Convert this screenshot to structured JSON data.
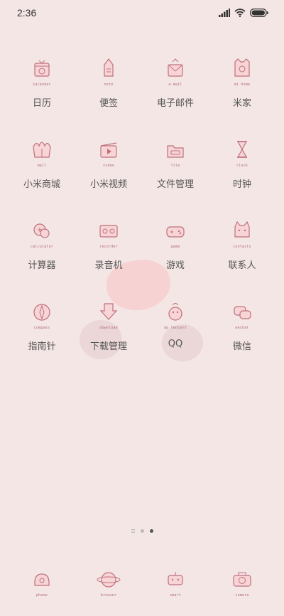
{
  "status_bar": {
    "time": "2:36"
  },
  "home_grid": [
    {
      "label": "日历",
      "tiny": "calendar",
      "icon": "calendar-icon"
    },
    {
      "label": "便签",
      "tiny": "note",
      "icon": "note-icon"
    },
    {
      "label": "电子邮件",
      "tiny": "e-mail",
      "icon": "email-icon"
    },
    {
      "label": "米家",
      "tiny": "mi home",
      "icon": "mi-home-icon"
    },
    {
      "label": "小米商城",
      "tiny": "mall",
      "icon": "mall-icon"
    },
    {
      "label": "小米视频",
      "tiny": "video",
      "icon": "video-icon"
    },
    {
      "label": "文件管理",
      "tiny": "file",
      "icon": "file-icon"
    },
    {
      "label": "时钟",
      "tiny": "clock",
      "icon": "clock-icon"
    },
    {
      "label": "计算器",
      "tiny": "calculator",
      "icon": "calculator-icon"
    },
    {
      "label": "录音机",
      "tiny": "recorder",
      "icon": "recorder-icon"
    },
    {
      "label": "游戏",
      "tiny": "game",
      "icon": "game-icon"
    },
    {
      "label": "联系人",
      "tiny": "contacts",
      "icon": "contacts-icon"
    },
    {
      "label": "指南针",
      "tiny": "compass",
      "icon": "compass-icon"
    },
    {
      "label": "下载管理",
      "tiny": "download",
      "icon": "download-icon"
    },
    {
      "label": "QQ",
      "tiny": "qq tencent",
      "icon": "qq-icon"
    },
    {
      "label": "微信",
      "tiny": "wechat",
      "icon": "wechat-icon"
    }
  ],
  "dock": [
    {
      "tiny": "phone",
      "icon": "phone-icon"
    },
    {
      "tiny": "browser",
      "icon": "browser-icon"
    },
    {
      "tiny": "smart",
      "icon": "smart-icon"
    },
    {
      "tiny": "camera",
      "icon": "camera-icon"
    }
  ],
  "pager": {
    "page_count": 2,
    "active_index": 1
  },
  "colors": {
    "background": "#f3e6e4",
    "icon_stroke": "#c0707c",
    "icon_fill": "#f7d4d6"
  }
}
